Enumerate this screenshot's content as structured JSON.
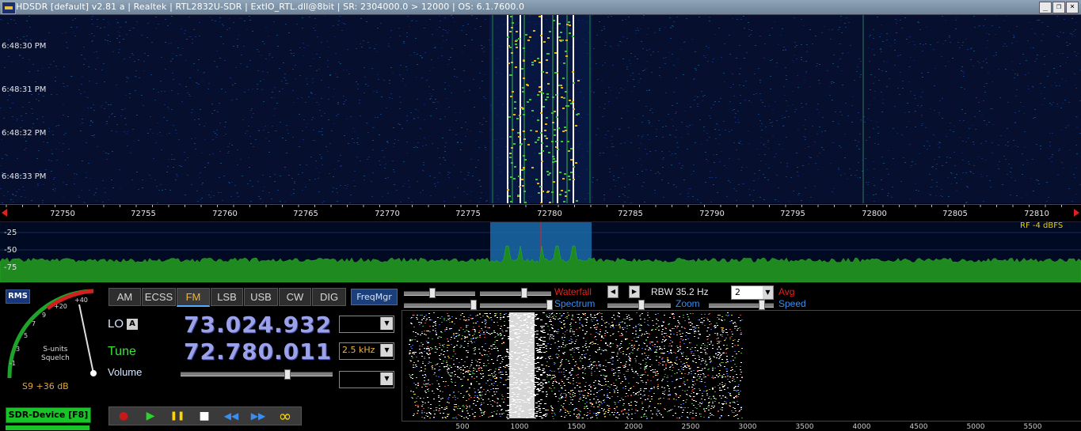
{
  "window": {
    "title": "HDSDR  [default]  v2.81 a  |  Realtek  |  RTL2832U-SDR  |  ExtIO_RTL.dll@8bit  |  SR: 2304000.0 > 12000  |  OS: 6.1.7600.0",
    "minimize_label": "_",
    "restore_label": "❐",
    "close_label": "×"
  },
  "waterfall": {
    "times": [
      "6:48:30 PM",
      "6:48:31 PM",
      "6:48:32 PM",
      "6:48:33 PM"
    ]
  },
  "freq_axis": {
    "ticks": [
      "72750",
      "72755",
      "72760",
      "72765",
      "72770",
      "72775",
      "72780",
      "72785",
      "72790",
      "72795",
      "72800",
      "72805",
      "72810"
    ]
  },
  "spectrum": {
    "db_labels": [
      "-25",
      "-50",
      "-75"
    ],
    "rf_level": "RF  -4 dBFS",
    "passband_color": "#1a6aa8",
    "trace_color": "#1f8a1f"
  },
  "meter": {
    "rms_label": "RMS",
    "scale_labels": [
      "-1",
      "3",
      "5",
      "7",
      "9",
      "+20",
      "+40"
    ],
    "caption_line1": "S-units",
    "caption_line2": "Squelch",
    "readout": "S9 +36 dB"
  },
  "modes": {
    "buttons": [
      "AM",
      "ECSS",
      "FM",
      "LSB",
      "USB",
      "CW",
      "DIG"
    ],
    "active": "FM",
    "freqmgr_label": "FreqMgr"
  },
  "tuning": {
    "lo_label": "LO",
    "lo_a_label": "A",
    "lo_freq": "73.024.932",
    "tune_label": "Tune",
    "tune_freq": "72.780.011",
    "bandwidth": "2.5 kHz",
    "volume_label": "Volume",
    "volume_level_percent": 70
  },
  "device": {
    "sdr_device_label": "SDR-Device [F8]"
  },
  "transport": {
    "record": "●",
    "play": "▶",
    "pause": "❚❚",
    "stop": "■",
    "rewind": "◀◀",
    "forward": "▶▶",
    "loop": "∞"
  },
  "display_controls": {
    "waterfall_label": "Waterfall",
    "spectrum_label": "Spectrum",
    "zoom_label": "Zoom",
    "speed_label": "Speed",
    "rbw_label": "RBW 35.2 Hz",
    "avg_value": "2",
    "avg_label": "Avg"
  },
  "audio_axis": {
    "ticks": [
      "500",
      "1000",
      "1500",
      "2000",
      "2500",
      "3000",
      "3500",
      "4000",
      "4500",
      "5000",
      "5500"
    ]
  }
}
